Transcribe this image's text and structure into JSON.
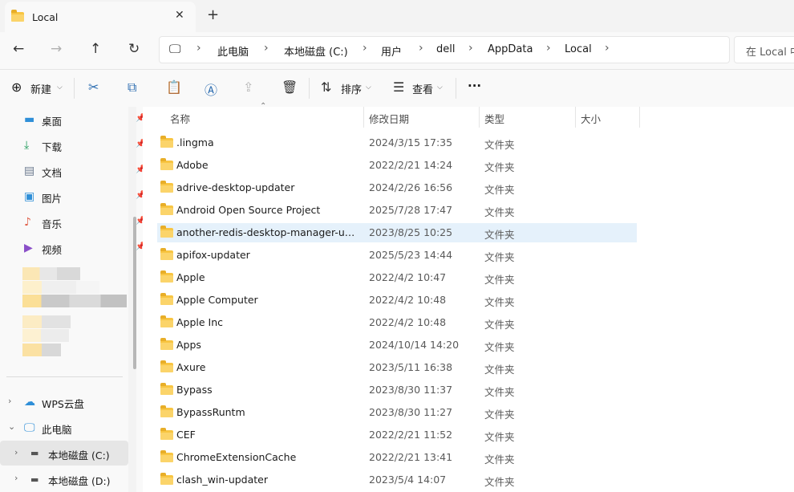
{
  "tab": {
    "title": "Local",
    "close": "✕",
    "new": "+"
  },
  "address": {
    "crumbs": [
      "此电脑",
      "本地磁盘 (C:)",
      "用户",
      "dell",
      "AppData",
      "Local"
    ],
    "search_placeholder": "在 Local 中"
  },
  "toolbar": {
    "new_label": "新建",
    "sort_label": "排序",
    "view_label": "查看",
    "more": "···"
  },
  "sidebar": {
    "quick": [
      {
        "label": "桌面",
        "icon": "desktop-icon",
        "color": "#2f8fd8"
      },
      {
        "label": "下载",
        "icon": "download-icon",
        "color": "#1f9a5a"
      },
      {
        "label": "文档",
        "icon": "document-icon",
        "color": "#6b7a8f"
      },
      {
        "label": "图片",
        "icon": "picture-icon",
        "color": "#2f8fd8"
      },
      {
        "label": "音乐",
        "icon": "music-icon",
        "color": "#e0604a"
      },
      {
        "label": "视频",
        "icon": "video-icon",
        "color": "#8a4fc8"
      }
    ],
    "tree": [
      {
        "label": "WPS云盘",
        "icon": "cloud-icon",
        "expanded": false
      },
      {
        "label": "此电脑",
        "icon": "computer-icon",
        "expanded": true
      },
      {
        "label": "本地磁盘 (C:)",
        "icon": "drive-icon",
        "expanded": false,
        "selected": true
      },
      {
        "label": "本地磁盘 (D:)",
        "icon": "drive-icon",
        "expanded": false
      }
    ]
  },
  "columns": {
    "name": "名称",
    "date": "修改日期",
    "type": "类型",
    "size": "大小"
  },
  "files": [
    {
      "name": ".lingma",
      "date": "2024/3/15 17:35",
      "type": "文件夹"
    },
    {
      "name": "Adobe",
      "date": "2022/2/21 14:24",
      "type": "文件夹"
    },
    {
      "name": "adrive-desktop-updater",
      "date": "2024/2/26 16:56",
      "type": "文件夹"
    },
    {
      "name": "Android Open Source Project",
      "date": "2025/7/28 17:47",
      "type": "文件夹"
    },
    {
      "name": "another-redis-desktop-manager-upd...",
      "date": "2023/8/25 10:25",
      "type": "文件夹",
      "selected": true
    },
    {
      "name": "apifox-updater",
      "date": "2025/5/23 14:44",
      "type": "文件夹"
    },
    {
      "name": "Apple",
      "date": "2022/4/2 10:47",
      "type": "文件夹"
    },
    {
      "name": "Apple Computer",
      "date": "2022/4/2 10:48",
      "type": "文件夹"
    },
    {
      "name": "Apple Inc",
      "date": "2022/4/2 10:48",
      "type": "文件夹"
    },
    {
      "name": "Apps",
      "date": "2024/10/14 14:20",
      "type": "文件夹"
    },
    {
      "name": "Axure",
      "date": "2023/5/11 16:38",
      "type": "文件夹"
    },
    {
      "name": "Bypass",
      "date": "2023/8/30 11:37",
      "type": "文件夹"
    },
    {
      "name": "BypassRuntm",
      "date": "2023/8/30 11:27",
      "type": "文件夹"
    },
    {
      "name": "CEF",
      "date": "2022/2/21 11:52",
      "type": "文件夹"
    },
    {
      "name": "ChromeExtensionCache",
      "date": "2022/2/21 13:41",
      "type": "文件夹"
    },
    {
      "name": "clash_win-updater",
      "date": "2023/5/4 14:07",
      "type": "文件夹"
    }
  ]
}
